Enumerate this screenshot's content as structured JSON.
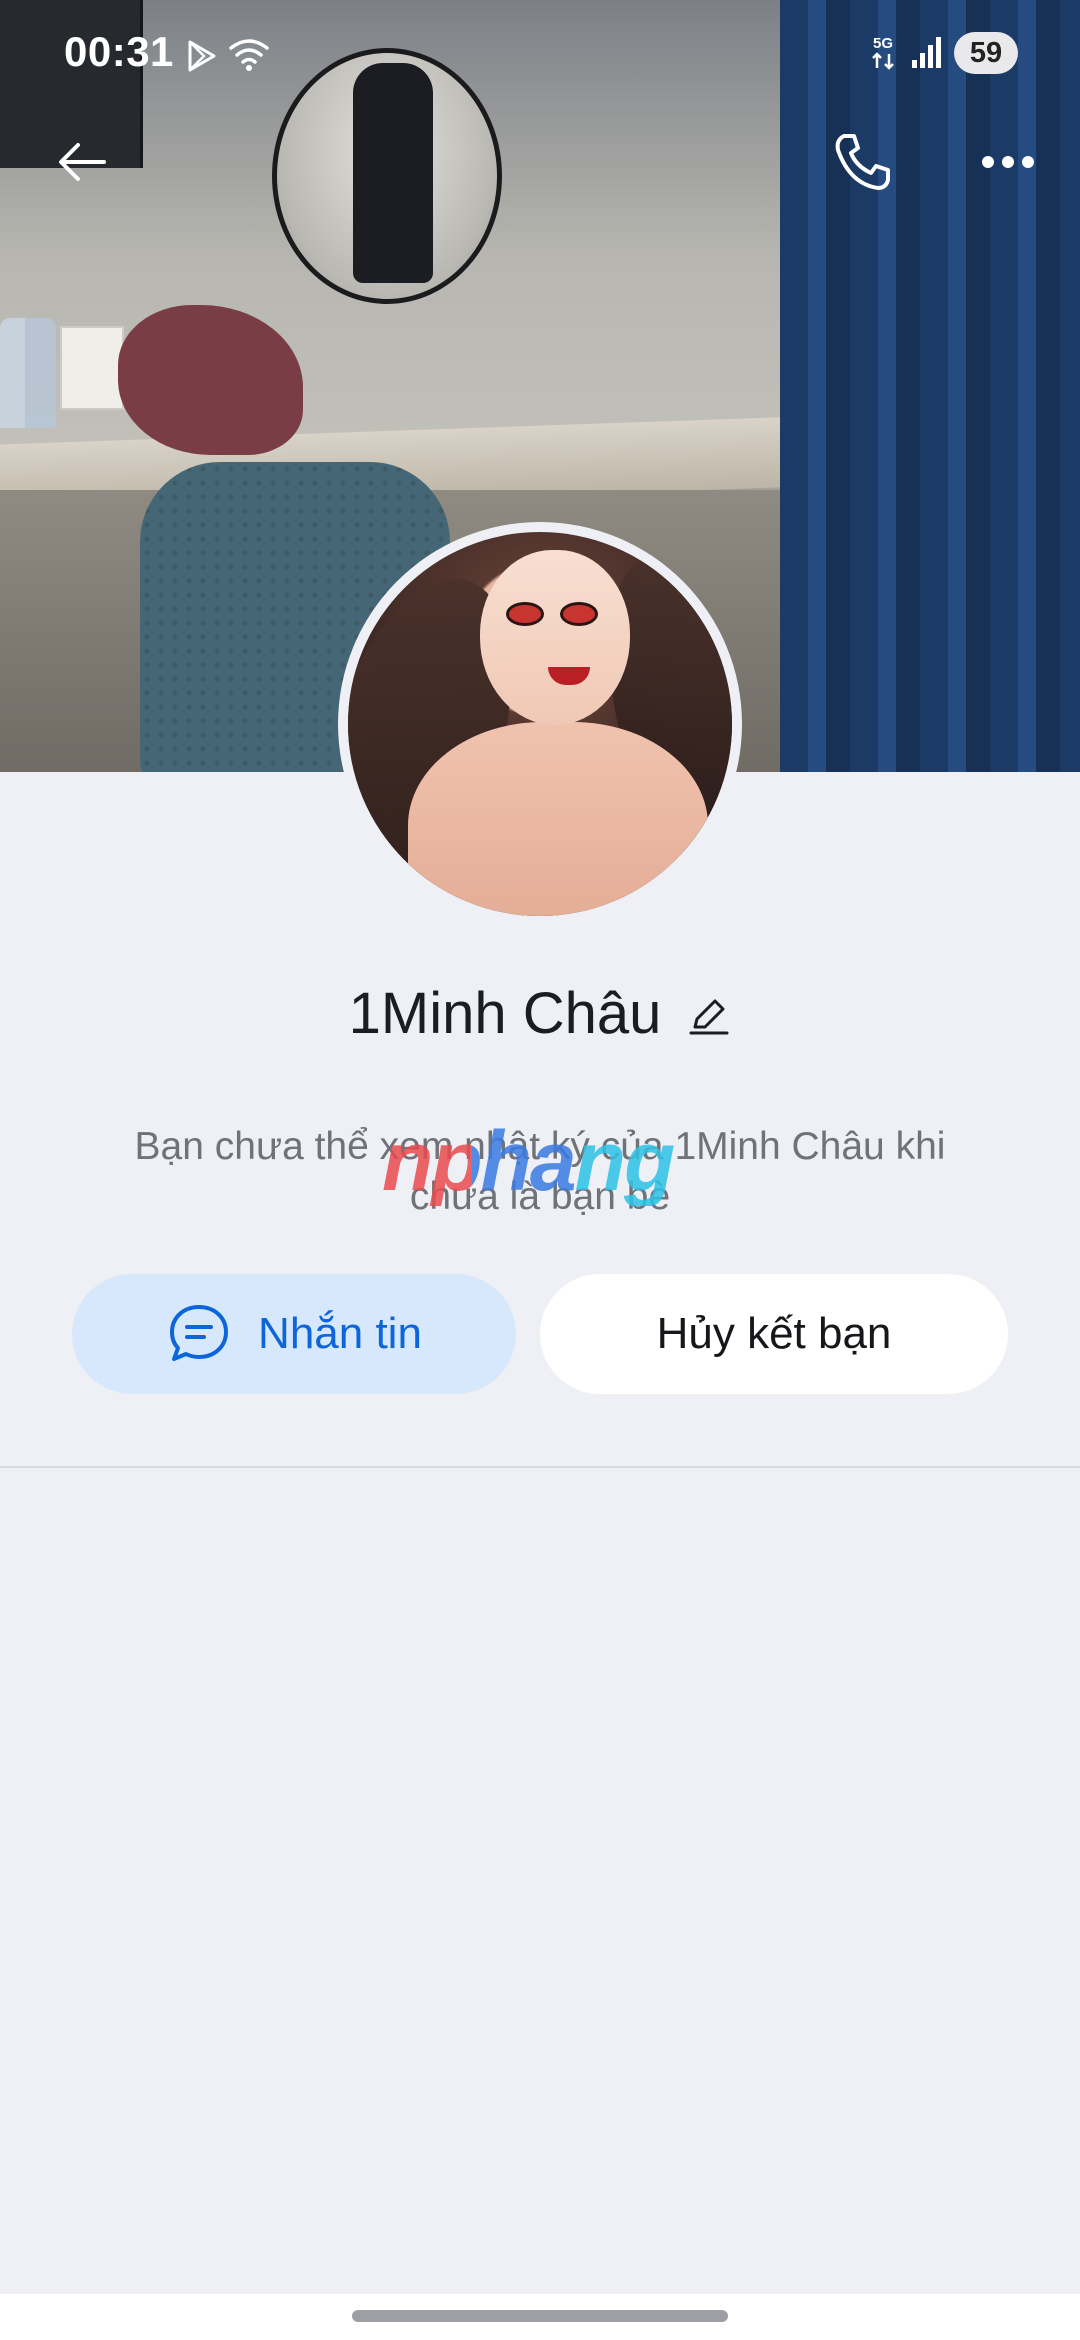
{
  "status_bar": {
    "time": "00:31",
    "network": "5G",
    "battery": "59"
  },
  "icons": {
    "back": "arrow-left-icon",
    "call": "phone-icon",
    "more": "more-horizontal-icon",
    "edit": "pencil-icon",
    "message": "chat-bubble-icon"
  },
  "profile": {
    "name": "1Minh Châu",
    "notice": "Bạn chưa thể xem nhật ký của 1Minh Châu khi chưa là bạn bè"
  },
  "watermark": "nphang",
  "actions": {
    "message_label": "Nhắn tin",
    "unfriend_label": "Hủy kết bạn"
  },
  "colors": {
    "accent": "#0c66d9",
    "message_button_bg": "#d7e8fd",
    "page_bg": "#eff0f5"
  }
}
